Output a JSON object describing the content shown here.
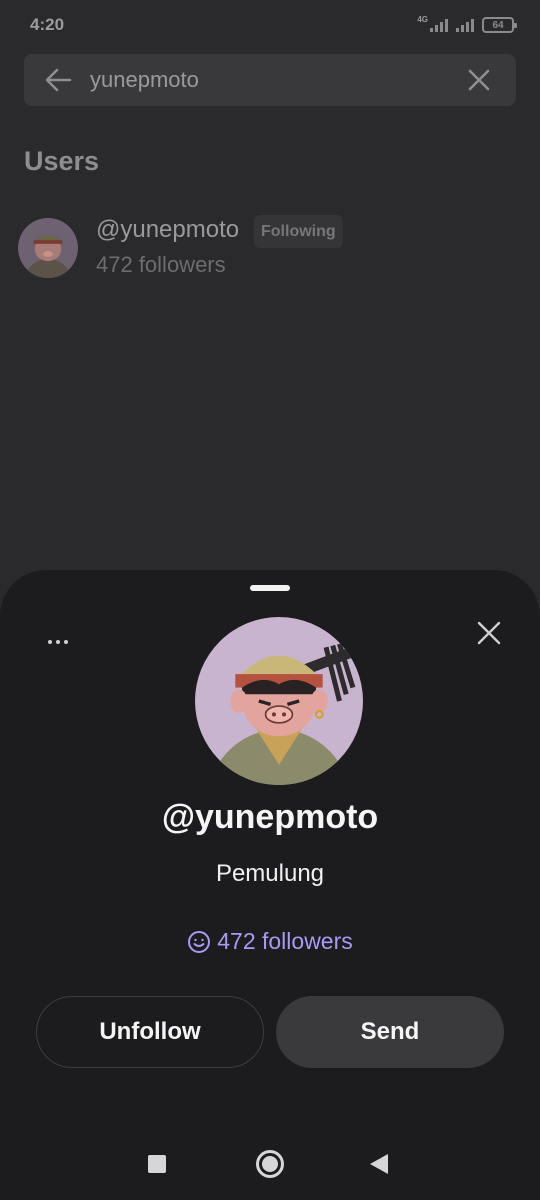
{
  "status_bar": {
    "time": "4:20",
    "network": "4G",
    "battery": "64"
  },
  "search": {
    "value": "yunepmoto",
    "back_icon": "arrow-left-icon",
    "clear_icon": "close-icon"
  },
  "results": {
    "section_title": "Users",
    "users": [
      {
        "handle": "@yunepmoto",
        "badge": "Following",
        "followers": "472 followers"
      }
    ]
  },
  "profile_sheet": {
    "handle": "@yunepmoto",
    "bio": "Pemulung",
    "followers": "472 followers",
    "unfollow_label": "Unfollow",
    "send_label": "Send",
    "accent_color": "#a99af5",
    "avatar_bg": "#c9b4cf"
  },
  "nav_bar": {
    "icons": [
      "recent-apps-icon",
      "home-icon",
      "back-icon"
    ]
  }
}
